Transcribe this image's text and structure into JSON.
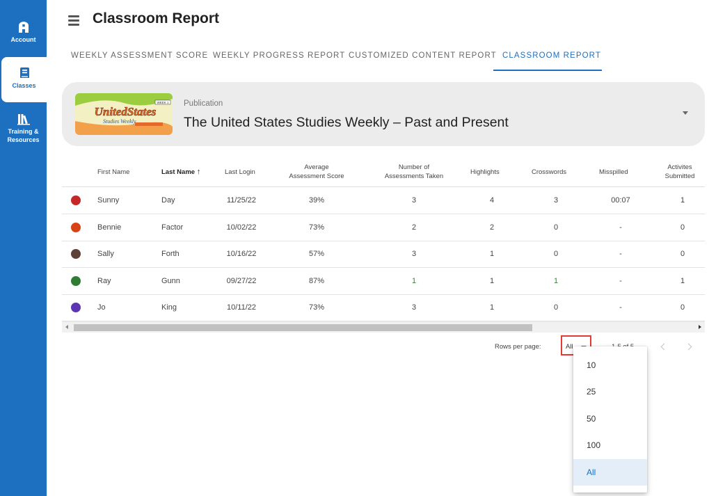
{
  "sidebar": {
    "items": [
      {
        "label": "Account",
        "icon": "account-icon"
      },
      {
        "label": "Classes",
        "icon": "book-icon",
        "active": true
      },
      {
        "label": "Training & Resources",
        "icon": "library-icon"
      }
    ]
  },
  "header": {
    "title": "Classroom Report"
  },
  "tabs": [
    {
      "label": "WEEKLY ASSESSMENT SCORE"
    },
    {
      "label": "WEEKLY PROGRESS REPORT"
    },
    {
      "label": "CUSTOMIZED CONTENT REPORT"
    },
    {
      "label": "CLASSROOM REPORT",
      "active": true
    }
  ],
  "publication": {
    "label": "Publication",
    "title": "The United States Studies Weekly – Past and Present",
    "thumb_text": "UnitedStates",
    "thumb_sub": "Studies Weekly",
    "thumb_week": "WEEK 1"
  },
  "table": {
    "columns": {
      "first_name": "First Name",
      "last_name": "Last Name",
      "sort_arrow": "↑",
      "last_login": "Last Login",
      "avg_score_1": "Average",
      "avg_score_2": "Assessment Score",
      "num_taken_1": "Number of",
      "num_taken_2": "Assessments Taken",
      "highlights": "Highlights",
      "crosswords": "Crosswords",
      "misspilled": "Misspilled",
      "activities_1": "Activites",
      "activities_2": "Submitted"
    },
    "rows": [
      {
        "first": "Sunny",
        "last": "Day",
        "login": "11/25/22",
        "avg": "39%",
        "taken": "3",
        "highlights": "4",
        "crosswords": "3",
        "misspilled": "00:07",
        "activities": "1",
        "avatar_color": "#c62828"
      },
      {
        "first": "Bennie",
        "last": "Factor",
        "login": "10/02/22",
        "avg": "73%",
        "taken": "2",
        "highlights": "2",
        "crosswords": "0",
        "misspilled": "-",
        "activities": "0",
        "avatar_color": "#d84315"
      },
      {
        "first": "Sally",
        "last": "Forth",
        "login": "10/16/22",
        "avg": "57%",
        "taken": "3",
        "highlights": "1",
        "crosswords": "0",
        "misspilled": "-",
        "activities": "0",
        "avatar_color": "#5d4037"
      },
      {
        "first": "Ray",
        "last": "Gunn",
        "login": "09/27/22",
        "avg": "87%",
        "taken": "1",
        "highlights": "1",
        "crosswords": "1",
        "misspilled": "-",
        "activities": "1",
        "avatar_color": "#2e7d32"
      },
      {
        "first": "Jo",
        "last": "King",
        "login": "10/11/22",
        "avg": "73%",
        "taken": "3",
        "highlights": "1",
        "crosswords": "0",
        "misspilled": "-",
        "activities": "0",
        "avatar_color": "#5e35b1"
      }
    ]
  },
  "pagination": {
    "rows_per_page_label": "Rows per page:",
    "selected": "All",
    "range": "1-5 of 5",
    "options": [
      "10",
      "25",
      "50",
      "100",
      "All"
    ]
  },
  "colors": {
    "brand": "#1d6fbf",
    "highlight": "#e53935"
  }
}
